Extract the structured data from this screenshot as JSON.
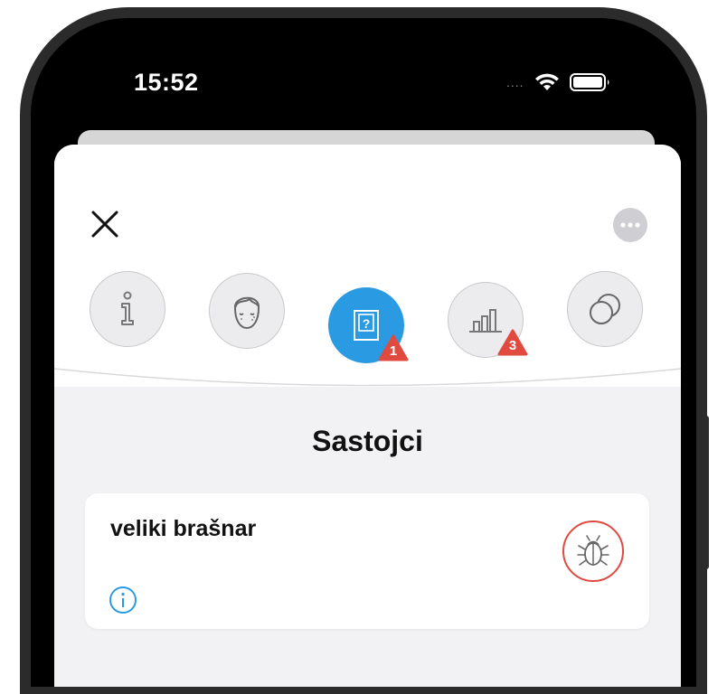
{
  "status_bar": {
    "time": "15:52",
    "signal": "....",
    "wifi_icon": "wifi-icon",
    "battery_icon": "battery-icon"
  },
  "header": {
    "close_icon": "close-icon",
    "more_icon": "more-options-icon"
  },
  "tabs": [
    {
      "icon": "info-icon",
      "active": false,
      "badge": null
    },
    {
      "icon": "face-icon",
      "active": false,
      "badge": null
    },
    {
      "icon": "question-card-icon",
      "active": true,
      "badge": "1"
    },
    {
      "icon": "bar-chart-icon",
      "active": false,
      "badge": "3"
    },
    {
      "icon": "circles-icon",
      "active": false,
      "badge": null
    }
  ],
  "section": {
    "title": "Sastojci"
  },
  "ingredient": {
    "name": "veliki brašnar",
    "action_icon": "bug-icon",
    "info_icon": "info-circle-icon"
  },
  "colors": {
    "accent": "#2a9be3",
    "warning": "#e04a3f",
    "sheet_bg": "#f2f2f4"
  }
}
